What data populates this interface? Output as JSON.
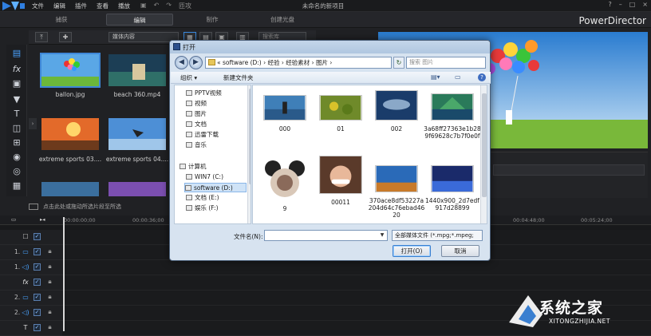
{
  "menu": {
    "items": [
      "文件",
      "编辑",
      "插件",
      "查看",
      "播放"
    ]
  },
  "project_title": "未命名的新项目",
  "quick_access": {
    "redo_label": "匝攻"
  },
  "mode_tabs": [
    {
      "label": "捕获",
      "active": false
    },
    {
      "label": "编辑",
      "active": true
    },
    {
      "label": "制作",
      "active": false
    },
    {
      "label": "创建光盘",
      "active": false
    }
  ],
  "brand": "PowerDirector",
  "library": {
    "filter_value": "媒体内容",
    "search_placeholder": "搜索库",
    "items": [
      {
        "label": "ballon.jpg",
        "selected": true
      },
      {
        "label": "beach 360.mp4",
        "selected": false
      },
      {
        "label": "extreme sports 03....",
        "selected": false
      },
      {
        "label": "extreme sports 04....",
        "selected": false
      },
      {
        "label": "",
        "selected": false
      },
      {
        "label": "",
        "selected": false
      }
    ],
    "hint": "点击此处或拖动所选片段至所选"
  },
  "timeline": {
    "ticks": [
      "00:00:00;00",
      "00:00:36;00",
      "00:04:48;00",
      "00:05:24;00"
    ],
    "tracks": [
      {
        "num": "",
        "icon": "☐"
      },
      {
        "num": "1.",
        "icon": "▭"
      },
      {
        "num": "1.",
        "icon": "◁)"
      },
      {
        "num": "",
        "icon": "fx"
      },
      {
        "num": "2.",
        "icon": "▭"
      },
      {
        "num": "2.",
        "icon": "◁)"
      },
      {
        "num": "",
        "icon": "T"
      }
    ]
  },
  "dialog": {
    "title": "打开",
    "address": "«  software (D:)  ›  经验  ›  经验素材  ›  图片  ›",
    "search_placeholder": "搜索 图片",
    "organize": "组织 ▾",
    "new_folder": "新建文件夹",
    "nav": [
      {
        "label": "PPTV视频",
        "selected": false
      },
      {
        "label": "视频",
        "selected": false
      },
      {
        "label": "图片",
        "selected": false
      },
      {
        "label": "文档",
        "selected": false
      },
      {
        "label": "迅雷下载",
        "selected": false
      },
      {
        "label": "音乐",
        "selected": false
      },
      {
        "label": "计算机",
        "selected": false
      },
      {
        "label": "WIN7 (C:)",
        "selected": false
      },
      {
        "label": "software (D:)",
        "selected": true
      },
      {
        "label": "文档 (E:)",
        "selected": false
      },
      {
        "label": "娱乐 (F:)",
        "selected": false
      }
    ],
    "files": [
      {
        "name": "000"
      },
      {
        "name": "01"
      },
      {
        "name": "002"
      },
      {
        "name": "3a68ff27363e1b289f69628c7b7f0e0f"
      },
      {
        "name": "9"
      },
      {
        "name": "00011"
      },
      {
        "name": "370ace8df53227a204d64c76ebad4620"
      },
      {
        "name": "1440x900_2d7edf917d28899"
      }
    ],
    "filename_label": "文件名(N):",
    "filename_value": "",
    "filetype_value": "全部媒体文件 (*.mpg;*.mpeg;",
    "open_label": "打开(O)",
    "cancel_label": "取消"
  },
  "watermark": {
    "text": "系统之家",
    "url": "XITONGZHIJIA.NET"
  }
}
